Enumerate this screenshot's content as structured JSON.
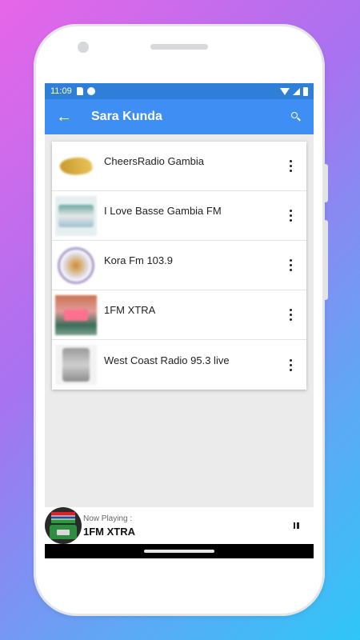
{
  "status_bar": {
    "time": "11:09"
  },
  "app_bar": {
    "title": "Sara Kunda",
    "back_icon": "arrow-back-icon",
    "search_icon": "search-icon"
  },
  "stations": [
    {
      "name": "CheersRadio Gambia",
      "logo": "cheers-radio-logo"
    },
    {
      "name": "I Love Basse Gambia FM",
      "logo": "basse-fm-logo"
    },
    {
      "name": "Kora Fm 103.9",
      "logo": "kora-fm-logo"
    },
    {
      "name": "1FM XTRA",
      "logo": "1fm-xtra-logo"
    },
    {
      "name": "West Coast Radio 95.3 live",
      "logo": "west-coast-radio-logo"
    }
  ],
  "player": {
    "label": "Now Playing :",
    "title": "1FM XTRA",
    "control_icon": "pause-icon"
  },
  "colors": {
    "app_bar": "#3e8ef4",
    "status_bar": "#2f7fd9"
  }
}
